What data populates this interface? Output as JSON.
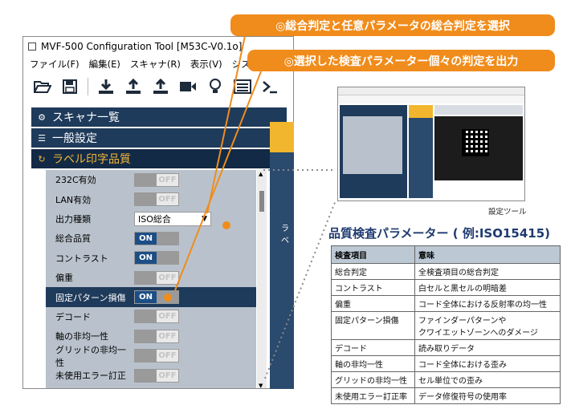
{
  "callouts": [
    "◎総合判定と任意パラメータの総合判定を選択",
    "◎選択した検査パラメーター個々の判定を出力"
  ],
  "window": {
    "title": "MVF-500 Configuration Tool [M53C-V0.1o]",
    "menu": [
      "ファイル(F)",
      "編集(E)",
      "スキャナ(R)",
      "表示(V)",
      "システム(S"
    ]
  },
  "toolbar_icons": [
    "open-folder-icon",
    "save-icon",
    "download-icon",
    "upload-icon",
    "upload-alt-icon",
    "camera-icon",
    "bulb-icon",
    "list-icon",
    "terminal-icon"
  ],
  "sections": [
    {
      "label": "スキャナ一覧",
      "icon": "gear-icon"
    },
    {
      "label": "一般設定",
      "icon": "sliders-icon"
    },
    {
      "label": "ラベル印字品質",
      "icon": "refresh-icon"
    }
  ],
  "params": [
    {
      "name": "232C有効",
      "type": "toggle",
      "state": "OFF"
    },
    {
      "name": "LAN有効",
      "type": "toggle",
      "state": "OFF"
    },
    {
      "name": "出力種類",
      "type": "select",
      "value": "ISO総合"
    },
    {
      "name": "総合品質",
      "type": "toggle",
      "state": "ON"
    },
    {
      "name": "コントラスト",
      "type": "toggle",
      "state": "ON"
    },
    {
      "name": "偏重",
      "type": "toggle",
      "state": "OFF"
    },
    {
      "name": "固定パターン損傷",
      "type": "toggle",
      "state": "ON"
    },
    {
      "name": "デコード",
      "type": "toggle",
      "state": "OFF"
    },
    {
      "name": "軸の非均一性",
      "type": "toggle",
      "state": "OFF"
    },
    {
      "name": "グリッドの非均一性",
      "type": "toggle",
      "state": "OFF"
    },
    {
      "name": "未使用エラー訂正",
      "type": "toggle",
      "state": "OFF"
    }
  ],
  "side_label": "ラベ",
  "thumbnail_caption": "設定ツール",
  "table": {
    "title": "品質検査パラメーター ( 例:ISO15415)",
    "headers": [
      "検査項目",
      "意味"
    ],
    "rows": [
      [
        "総合判定",
        "全検査項目の総合判定"
      ],
      [
        "コントラスト",
        "白セルと黒セルの明暗差"
      ],
      [
        "偏重",
        "コード全体における反射率の均一性"
      ],
      [
        "固定パターン損傷",
        "ファインダーパターンや\nクワイエットゾーンへのダメージ"
      ],
      [
        "デコード",
        "読み取りデータ"
      ],
      [
        "軸の非均一性",
        "コード全体における歪み"
      ],
      [
        "グリッドの非均一性",
        "セル単位での歪み"
      ],
      [
        "未使用エラー訂正率",
        "データ修復符号の使用率"
      ]
    ]
  },
  "colors": {
    "accent_orange": "#f08c1c",
    "nav_dark": "#1f3b5b",
    "toggle_on": "#1c4e86",
    "active_text": "#f3b73a"
  }
}
